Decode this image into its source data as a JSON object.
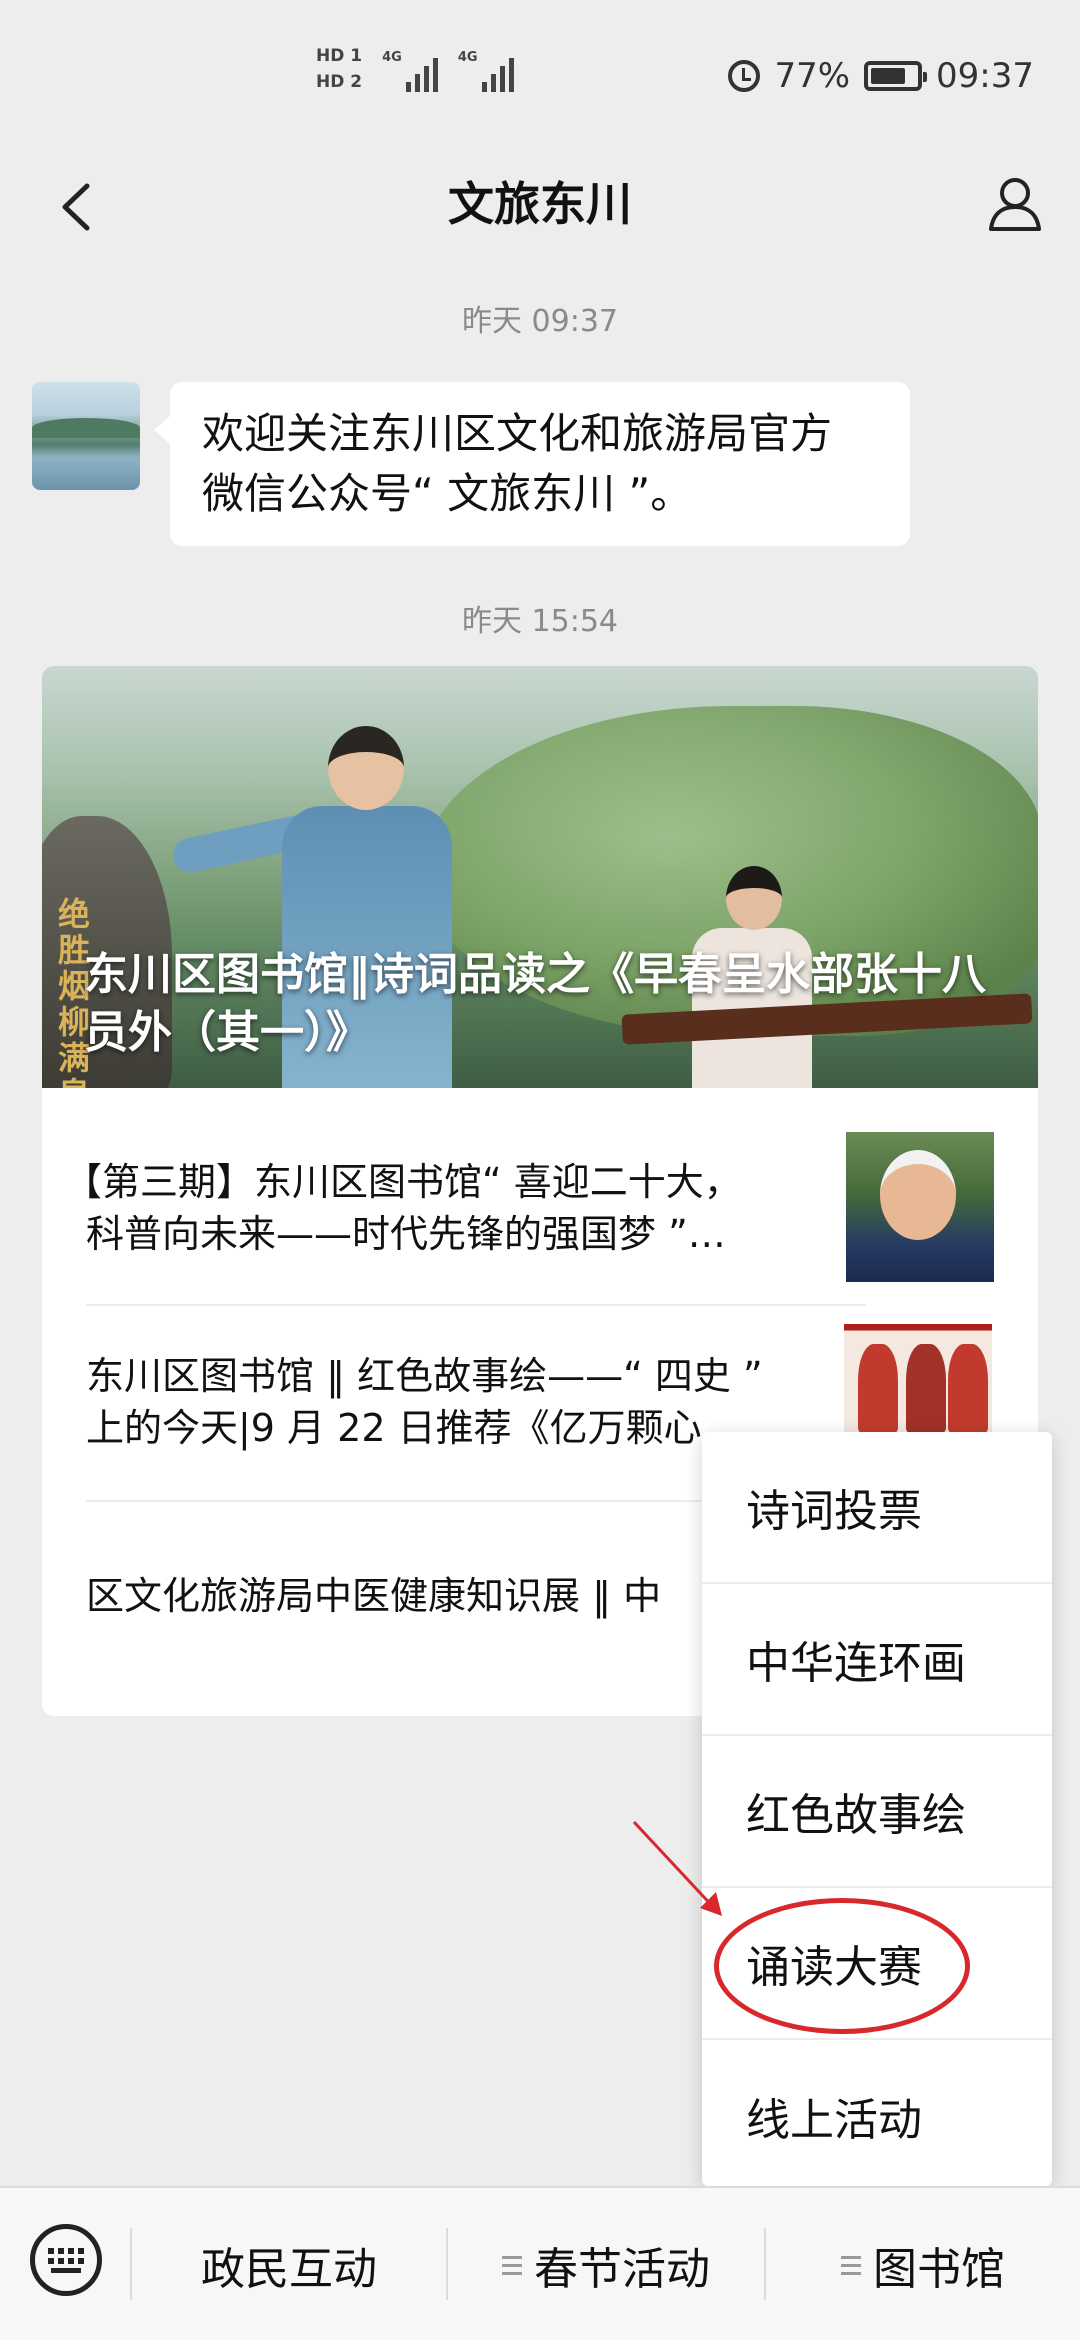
{
  "status_bar": {
    "sim1": "HD 1",
    "sim2": "HD 2",
    "network1": "4G",
    "network2": "4G",
    "battery": "77%",
    "time": "09:37"
  },
  "nav": {
    "title": "文旅东川"
  },
  "chat": {
    "messages": [
      {
        "timestamp": "昨天 09:37",
        "text_line1": "欢迎关注东川区文化和旅游局官方",
        "text_line2": "微信公众号“ 文旅东川 ”。"
      }
    ],
    "article_timestamp": "昨天 15:54"
  },
  "article_card": {
    "cover_text": "绝胜烟柳满皇都",
    "main_title": "东川区图书馆‖诗词品读之《早春呈水部张十八员外（其一）》",
    "items": [
      {
        "line1": "【第三期】东川区图书馆“ 喜迎二十大，",
        "line2": "科普向未来——时代先锋的强国梦 ”…"
      },
      {
        "line1": "东川区图书馆 ‖ 红色故事绘——“ 四史 ”",
        "line2": "上的今天|9 月 22 日推荐《亿万颗心"
      },
      {
        "line1": "区文化旅游局中医健康知识展 ‖ 中"
      }
    ]
  },
  "popup_menu": {
    "items": [
      "诗词投票",
      "中华连环画",
      "红色故事绘",
      "诵读大赛",
      "线上活动"
    ],
    "highlighted_index": 3
  },
  "bottom_bar": {
    "tabs": [
      "政民互动",
      "春节活动",
      "图书馆"
    ]
  },
  "colors": {
    "background": "#ededed",
    "highlight": "#d8282b"
  }
}
